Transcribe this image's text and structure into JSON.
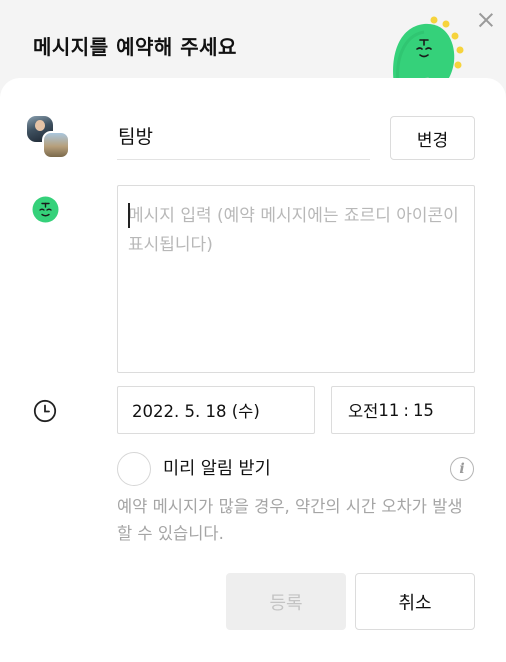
{
  "dialog": {
    "title": "메시지를 예약해 주세요",
    "close_icon": "close-icon"
  },
  "room": {
    "name": "팀방",
    "change_label": "변경"
  },
  "message": {
    "placeholder": "메시지 입력 (예약 메시지에는 죠르디 아이콘이 표시됩니다)"
  },
  "schedule": {
    "date": "2022. 5. 18 (수)",
    "ampm": "오전",
    "hour": "11",
    "separator": ":",
    "minute": "15"
  },
  "reminder": {
    "label": "미리 알림 받기",
    "checked": false
  },
  "notice": "예약 메시지가 많을 경우, 약간의 시간 오차가 발생할 수 있습니다.",
  "actions": {
    "register_label": "등록",
    "cancel_label": "취소"
  },
  "colors": {
    "mascot_green": "#35d17a",
    "mascot_yellow": "#f6d33c",
    "disabled_button_bg": "#eeeeee",
    "placeholder_text": "#b8b8b8"
  }
}
